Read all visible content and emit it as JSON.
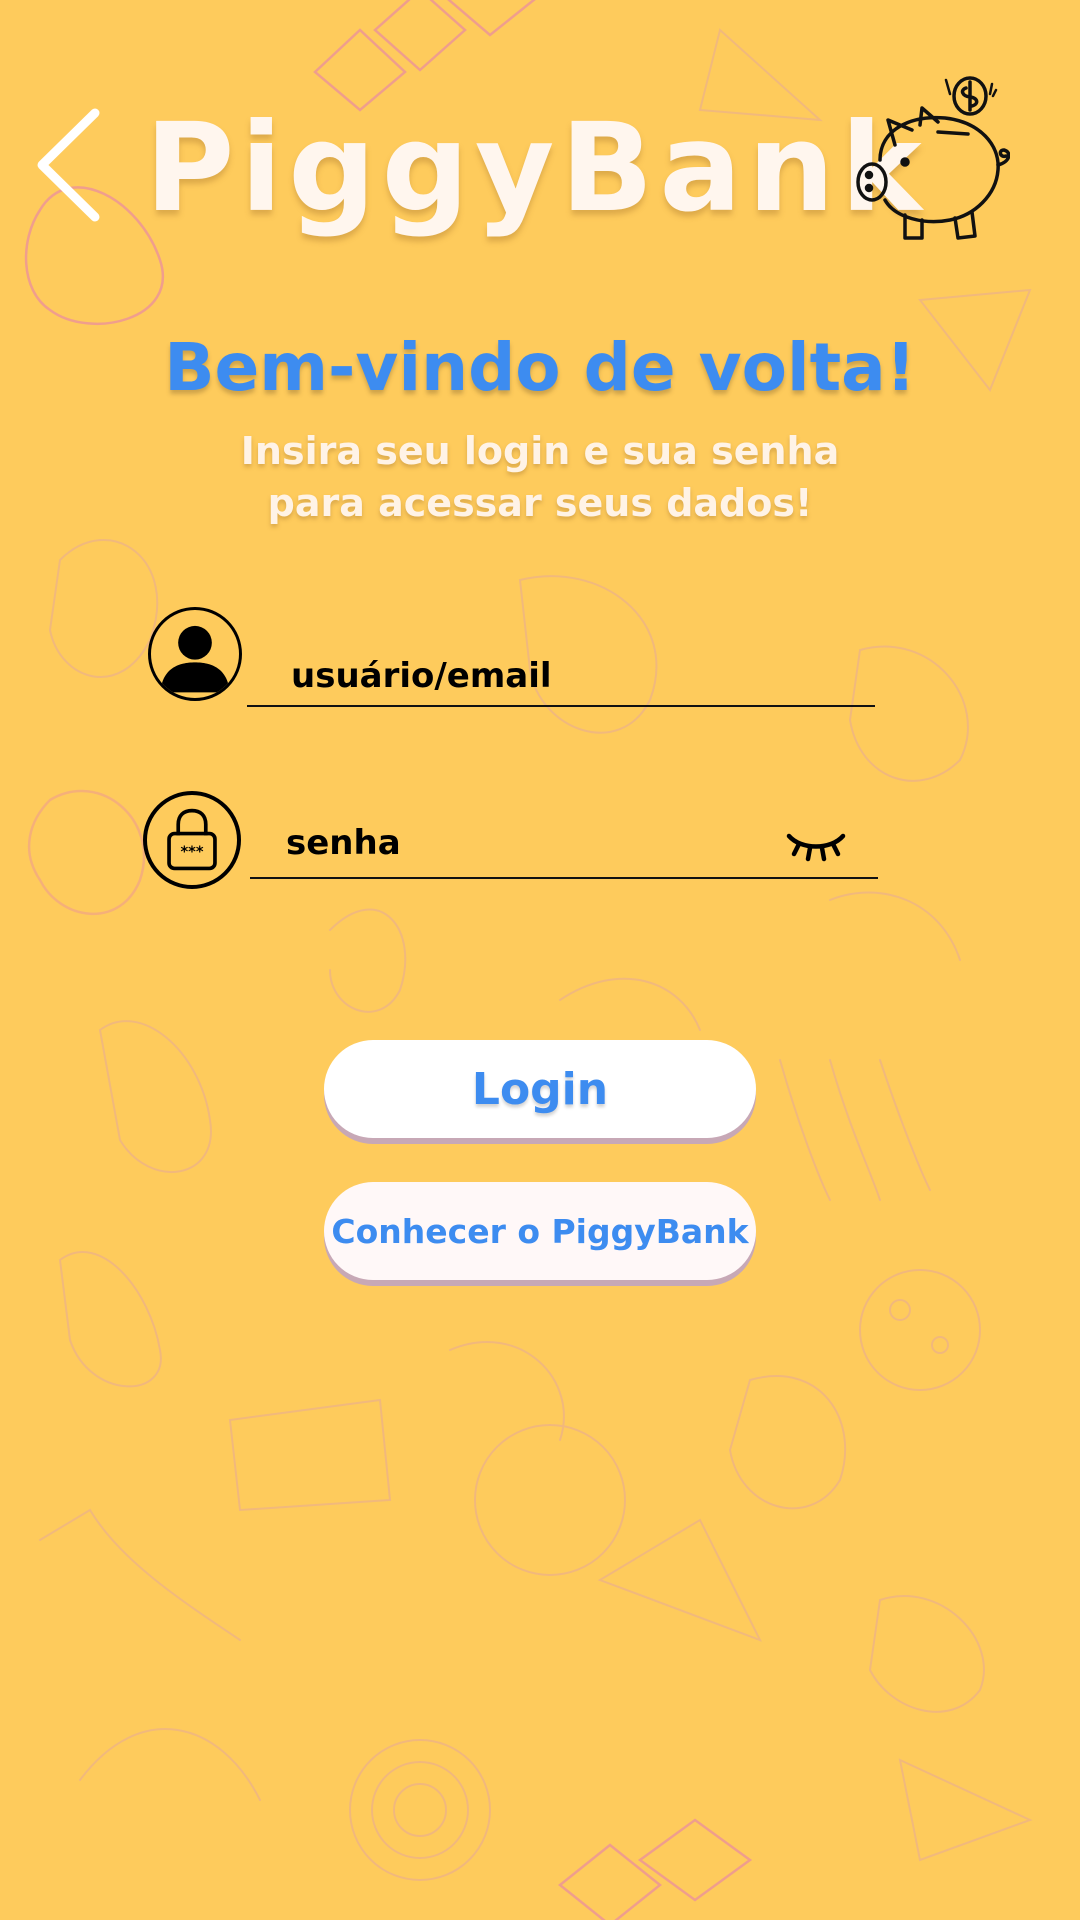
{
  "header": {
    "app_title": "PiggyBank",
    "back_icon": "chevron-left-icon",
    "logo_icon": "piggy-bank-icon"
  },
  "welcome": {
    "title": "Bem-vindo de volta!",
    "subtitle": "Insira seu login e sua senha para acessar seus dados!"
  },
  "form": {
    "user_placeholder": "usuário/email",
    "user_value": "",
    "user_icon": "user-icon",
    "password_placeholder": "senha",
    "password_value": "",
    "password_icon": "lock-icon",
    "visibility_icon": "eye-closed-icon"
  },
  "buttons": {
    "login_label": "Login",
    "about_label": "Conhecer o PiggyBank"
  },
  "colors": {
    "background": "#fecb5c",
    "accent_blue": "#3d8cf0",
    "title_white": "#fff6ee",
    "doodle_pink": "#e89aa4"
  }
}
